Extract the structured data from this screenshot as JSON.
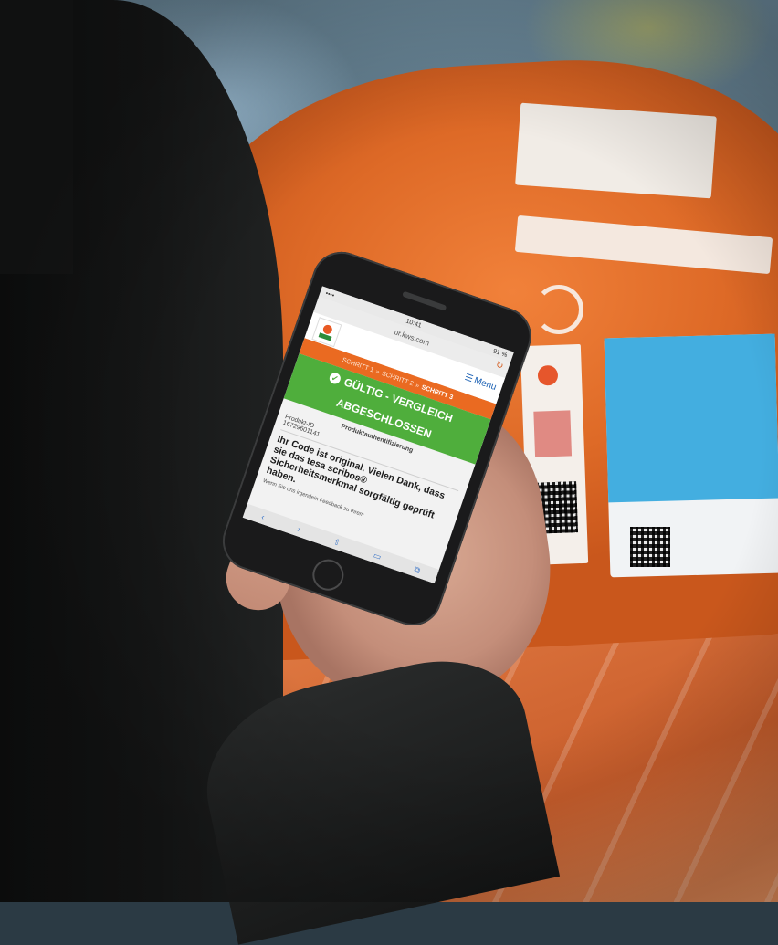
{
  "photo": {
    "subject": "Hand holding a smartphone showing a product authentication result in front of an orange parcel",
    "colors": {
      "parcel_orange": "#e8732e",
      "label_blue": "#43aee0",
      "status_green": "#4fae3c",
      "steps_orange": "#ea6a21"
    }
  },
  "phone_screen": {
    "statusbar": {
      "left": "••••",
      "time": "10:41",
      "right": "91 %"
    },
    "address": "ur.kws.com",
    "menu_label": "Menu",
    "steps": {
      "step1": "SCHRITT 1",
      "sep1": "»",
      "step2": "SCHRITT 2",
      "sep2": "»",
      "step3": "SCHRITT 3"
    },
    "status": {
      "line1": "GÜLTIG - VERGLEICH",
      "line2": "ABGESCHLOSSEN"
    },
    "section_title": "Produktauthentifizierung",
    "product_id_label": "Produkt-ID",
    "product_id_value": "16729601141",
    "message": "Ihr Code ist original. Vielen Dank, dass sie das tesa scribos® Sicherheitsmerkmal sorgfältig geprüft haben.",
    "feedback": "Wenn Sie uns irgendein Feedback zu Ihrem"
  }
}
